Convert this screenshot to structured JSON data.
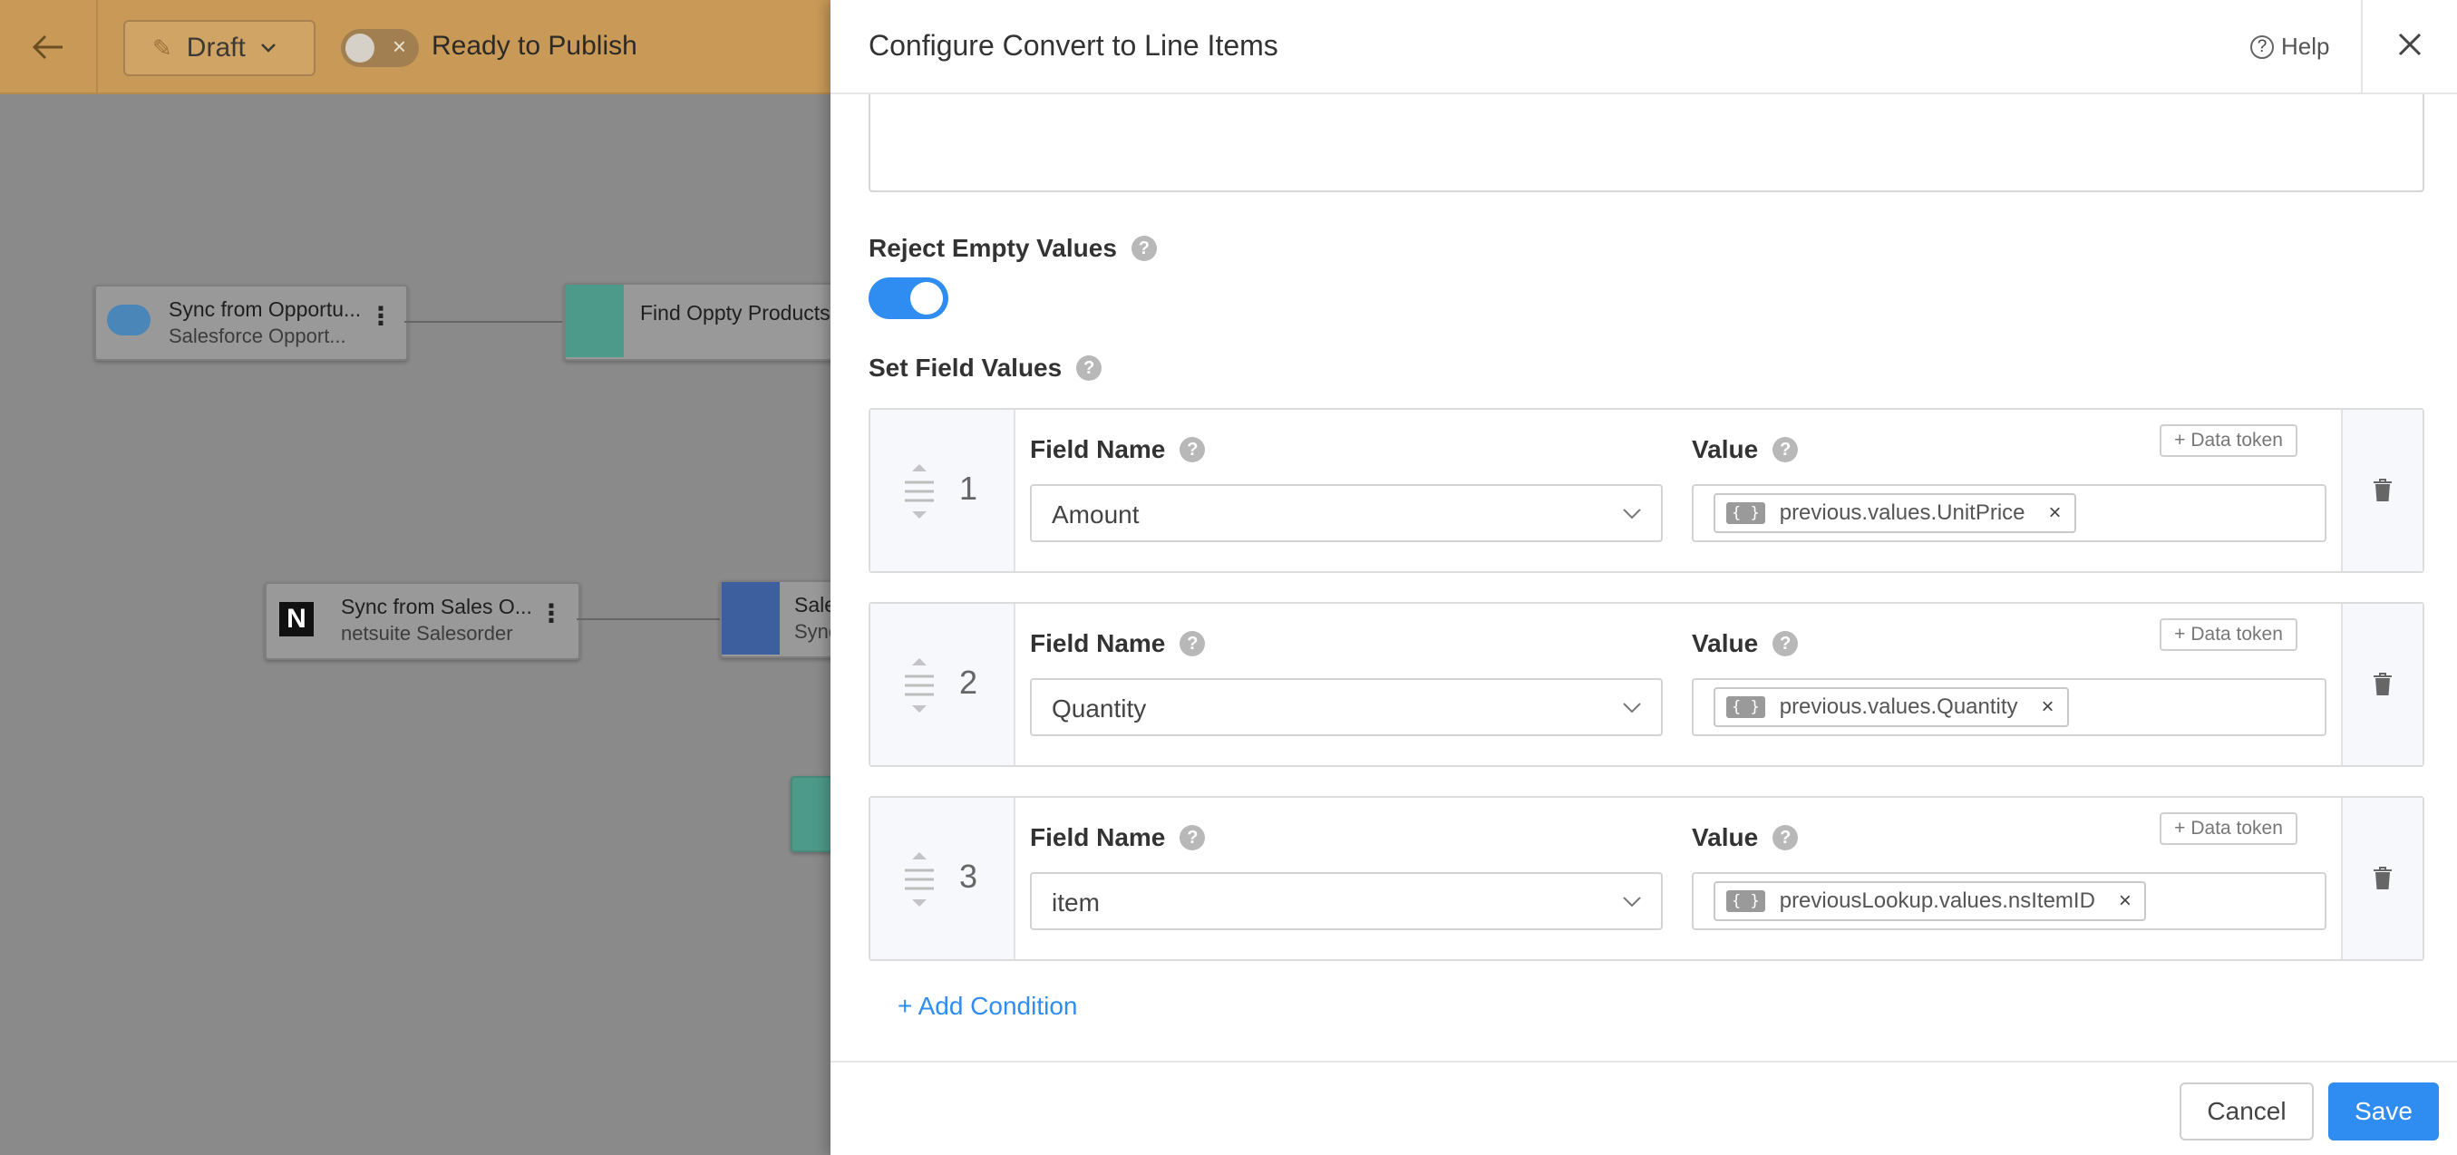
{
  "app": {
    "draft_label": "Draft",
    "ready_label": "Ready to Publish"
  },
  "canvas": {
    "nodes": [
      {
        "title": "Sync from Opportu...",
        "subtitle": "Salesforce Opport..."
      },
      {
        "title": "Find Oppty Products",
        "subtitle": ""
      },
      {
        "title": "Sync from Sales O...",
        "subtitle": "netsuite Salesorder"
      },
      {
        "title": "Sale",
        "subtitle": "Sync"
      }
    ]
  },
  "panel": {
    "title": "Configure Convert to Line Items",
    "help_label": "Help",
    "reject_empty_label": "Reject Empty Values",
    "reject_empty_on": true,
    "set_field_values_label": "Set Field Values",
    "rows": [
      {
        "num": "1",
        "field_label": "Field Name",
        "value_label": "Value",
        "data_token_label": "Data token",
        "field_value": "Amount",
        "token": "previous.values.UnitPrice"
      },
      {
        "num": "2",
        "field_label": "Field Name",
        "value_label": "Value",
        "data_token_label": "Data token",
        "field_value": "Quantity",
        "token": "previous.values.Quantity"
      },
      {
        "num": "3",
        "field_label": "Field Name",
        "value_label": "Value",
        "data_token_label": "Data token",
        "field_value": "item",
        "token": "previousLookup.values.nsItemID"
      }
    ],
    "add_condition_label": "+ Add Condition",
    "cancel_label": "Cancel",
    "save_label": "Save"
  },
  "colors": {
    "accent": "#2f8cf0",
    "topbar": "#c99a57"
  }
}
